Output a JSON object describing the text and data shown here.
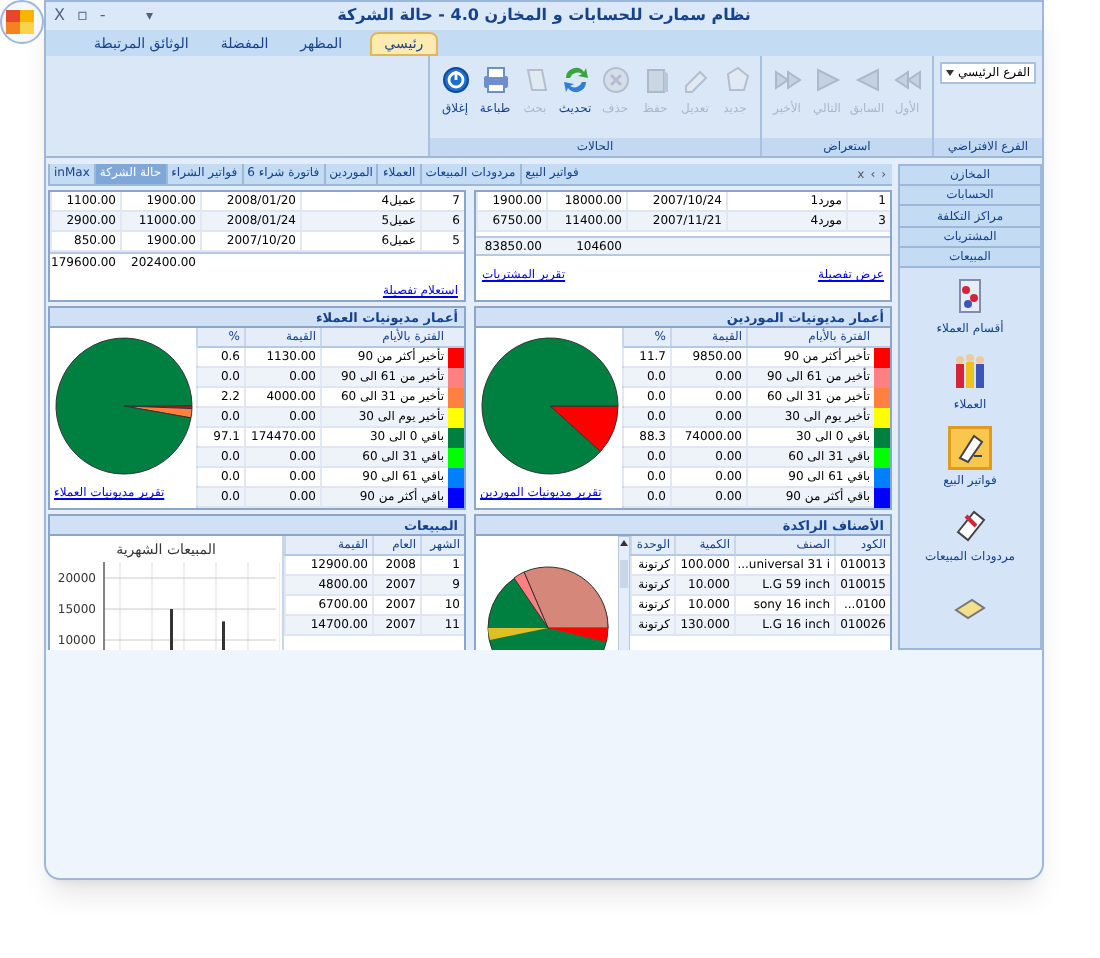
{
  "window": {
    "title": "نظام سمارت للحسابات و المخازن 4.0 - حالة الشركة",
    "quick_access": "▾",
    "controls": [
      "-",
      "▫",
      "X"
    ]
  },
  "ribbon_tabs": [
    {
      "label": "رئيسي",
      "selected": true
    },
    {
      "label": "المظهر",
      "selected": false
    },
    {
      "label": "المفضلة",
      "selected": false
    },
    {
      "label": "الوثائق المرتبطة",
      "selected": false
    }
  ],
  "ribbon_groups": [
    {
      "title": "الفرع الافتراضي",
      "kind": "dropdown",
      "value": "الفرع الرئيسي"
    },
    {
      "title": "استعراض",
      "kind": "buttons",
      "buttons": [
        {
          "label": "الأول",
          "kind": "first",
          "disabled": true
        },
        {
          "label": "السابق",
          "kind": "prev",
          "disabled": true
        },
        {
          "label": "التالي",
          "kind": "next",
          "disabled": true
        },
        {
          "label": "الأخير",
          "kind": "last",
          "disabled": true
        }
      ]
    },
    {
      "title": "الحالات",
      "kind": "buttons",
      "buttons": [
        {
          "label": "جديد",
          "kind": "new",
          "disabled": true
        },
        {
          "label": "تعديل",
          "kind": "edit",
          "disabled": true
        },
        {
          "label": "حفظ",
          "kind": "save",
          "disabled": true
        },
        {
          "label": "حذف",
          "kind": "delete",
          "disabled": true
        },
        {
          "label": "تحديث",
          "kind": "refresh",
          "disabled": false
        },
        {
          "label": "بحث",
          "kind": "search",
          "disabled": true
        },
        {
          "label": "طباعة",
          "kind": "print",
          "disabled": false
        },
        {
          "label": "إغلاق",
          "kind": "close",
          "disabled": false
        }
      ]
    }
  ],
  "sidebar": {
    "nav": [
      "المخازن",
      "الحسابات",
      "مراكز التكلفة",
      "المشتريات",
      "المبيعات"
    ],
    "items": [
      {
        "label": "أقسام العملاء",
        "kind": "groups",
        "selected": false
      },
      {
        "label": "العملاء",
        "kind": "people",
        "selected": false
      },
      {
        "label": "فواتير البيع",
        "kind": "invoice",
        "selected": true
      },
      {
        "label": "مردودات المبيعات",
        "kind": "returns",
        "selected": false
      },
      {
        "kind": "report",
        "selected": false
      }
    ]
  },
  "doc_tabs": [
    {
      "label": "فواتير البيع",
      "selected": false
    },
    {
      "label": "مردودات المبيعات",
      "selected": false
    },
    {
      "label": "العملاء",
      "selected": false
    },
    {
      "label": "الموردين",
      "selected": false
    },
    {
      "label": "فاتورة شراء 6",
      "selected": false
    },
    {
      "label": "فواتير الشراء",
      "selected": false
    },
    {
      "label": "حالة الشركة",
      "selected": true
    },
    {
      "label": "inMax",
      "selected": false
    }
  ],
  "tab_controls": [
    "‹",
    "›",
    "x"
  ],
  "suppliers_balances": {
    "rows": [
      [
        "1",
        "مورد1",
        "2007/10/24",
        "18000.00",
        "1900.00"
      ],
      [
        "3",
        "مورد4",
        "2007/11/21",
        "11400.00",
        "6750.00"
      ]
    ],
    "totals": [
      "104600",
      "83850.00"
    ],
    "links": [
      "عرض تفصيلة",
      "تقرير المشتريات"
    ]
  },
  "customers_balances": {
    "rows": [
      [
        "7",
        "عميل4",
        "2008/01/20",
        "1900.00",
        "1100.00"
      ],
      [
        "6",
        "عميل5",
        "2008/01/24",
        "11000.00",
        "2900.00"
      ],
      [
        "5",
        "عميل6",
        "2007/10/20",
        "1900.00",
        "850.00"
      ]
    ],
    "totals": [
      "202400.00",
      "179600.00"
    ],
    "links": [
      "استعلام تفصيلة"
    ]
  },
  "supplier_aging": {
    "title": "أعمار مديونيات الموردين",
    "columns": [
      "الفترة بالأيام",
      "القيمة",
      "%"
    ],
    "rows": [
      {
        "period": "تأخير أكثر من 90",
        "value": "9850.00",
        "percent": "11.7",
        "color": "#ff0000"
      },
      {
        "period": "تأخير من 61 الى 90",
        "value": "0.00",
        "percent": "0.0",
        "color": "#ff8080"
      },
      {
        "period": "تأخير من 31 الى 60",
        "value": "0.00",
        "percent": "0.0",
        "color": "#ff8040"
      },
      {
        "period": "تأخير يوم الى 30",
        "value": "0.00",
        "percent": "0.0",
        "color": "#ffff00"
      },
      {
        "period": "باقي 0 الى 30",
        "value": "74000.00",
        "percent": "88.3",
        "color": "#008040"
      },
      {
        "period": "باقي 31 الى 60",
        "value": "0.00",
        "percent": "0.0",
        "color": "#00ff00"
      },
      {
        "period": "باقي 61 الى 90",
        "value": "0.00",
        "percent": "0.0",
        "color": "#0080ff"
      },
      {
        "period": "باقي أكثر من 90",
        "value": "0.00",
        "percent": "0.0",
        "color": "#0000ff"
      }
    ],
    "link": "تقرير مديونيات الموردين"
  },
  "customer_aging": {
    "title": "أعمار مديونيات العملاء",
    "columns": [
      "الفترة بالأيام",
      "القيمة",
      "%"
    ],
    "rows": [
      {
        "period": "تأخير أكثر من 90",
        "value": "1130.00",
        "percent": "0.6",
        "color": "#ff0000"
      },
      {
        "period": "تأخير من 61 الى 90",
        "value": "0.00",
        "percent": "0.0",
        "color": "#ff8080"
      },
      {
        "period": "تأخير من 31 الى 60",
        "value": "4000.00",
        "percent": "2.2",
        "color": "#ff8040"
      },
      {
        "period": "تأخير يوم الى 30",
        "value": "0.00",
        "percent": "0.0",
        "color": "#ffff00"
      },
      {
        "period": "باقي 0 الى 30",
        "value": "174470.00",
        "percent": "97.1",
        "color": "#008040"
      },
      {
        "period": "باقي 31 الى 60",
        "value": "0.00",
        "percent": "0.0",
        "color": "#00ff00"
      },
      {
        "period": "باقي 61 الى 90",
        "value": "0.00",
        "percent": "0.0",
        "color": "#0080ff"
      },
      {
        "period": "باقي أكثر من 90",
        "value": "0.00",
        "percent": "0.0",
        "color": "#0000ff"
      }
    ],
    "link": "تقرير مديونيات العملاء"
  },
  "stagnant_items": {
    "title": "الأصناف الراكدة",
    "columns": [
      "الكود",
      "الصنف",
      "الكمية",
      "الوحدة"
    ],
    "rows": [
      [
        "010013",
        "universal 31 i...",
        "100.000",
        "كرتونة"
      ],
      [
        "010015",
        "L.G 59 inch",
        "10.000",
        "كرتونة"
      ],
      [
        "0100...",
        "sony 16 inch",
        "10.000",
        "كرتونة"
      ],
      [
        "010026",
        "L.G 16 inch",
        "130.000",
        "كرتونة"
      ]
    ]
  },
  "sales": {
    "title": "المبيعات",
    "columns": [
      "الشهر",
      "العام",
      "القيمة"
    ],
    "rows": [
      [
        "1",
        "2008",
        "12900.00"
      ],
      [
        "9",
        "2007",
        "4800.00"
      ],
      [
        "10",
        "2007",
        "6700.00"
      ],
      [
        "11",
        "2007",
        "14700.00"
      ]
    ],
    "chart_data": {
      "type": "bar",
      "title": "المبيعات الشهرية",
      "values": [
        15000,
        13000
      ],
      "yticks": [
        10000,
        15000,
        20000
      ],
      "ylim": [
        0,
        20000
      ]
    }
  }
}
